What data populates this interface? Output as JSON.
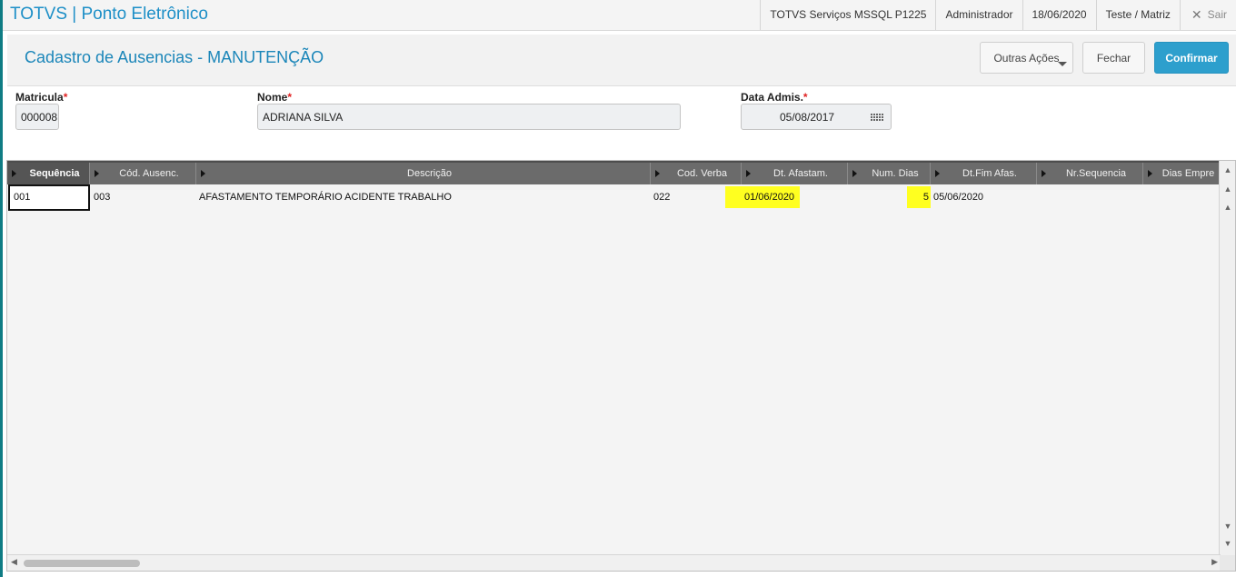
{
  "app": {
    "title": "TOTVS | Ponto Eletrônico",
    "environment": "TOTVS Serviços MSSQL P1225",
    "user": "Administrador",
    "date": "18/06/2020",
    "branch": "Teste / Matriz",
    "logout_label": "Sair"
  },
  "page": {
    "title": "Cadastro de Ausencias - MANUTENÇÃO",
    "buttons": {
      "outras_acoes": "Outras Ações",
      "fechar": "Fechar",
      "confirmar": "Confirmar"
    }
  },
  "form": {
    "matricula": {
      "label": "Matricula",
      "value": "000008"
    },
    "nome": {
      "label": "Nome",
      "value": "ADRIANA SILVA"
    },
    "data_admis": {
      "label": "Data Admis.",
      "value": "05/08/2017"
    },
    "required_mark": "*"
  },
  "grid": {
    "columns": [
      "Sequência",
      "Cód. Ausenc.",
      "Descrição",
      "Cod. Verba",
      "Dt. Afastam.",
      "Num. Dias",
      "Dt.Fim Afas.",
      "Nr.Sequencia",
      "Dias Empre"
    ],
    "rows": [
      {
        "sequencia": "001",
        "cod_ausenc": "003",
        "descricao": "AFASTAMENTO TEMPORÁRIO ACIDENTE TRABALHO",
        "cod_verba": "022",
        "dt_afastam": "01/06/2020",
        "num_dias": "5",
        "dt_fim_afas": "05/06/2020",
        "nr_sequencia": "",
        "dias_empre": ""
      }
    ],
    "highlight_color": "#ffff20",
    "scroll_up": "▲",
    "scroll_down": "▼",
    "scroll_left": "◀",
    "scroll_right": "▶"
  }
}
